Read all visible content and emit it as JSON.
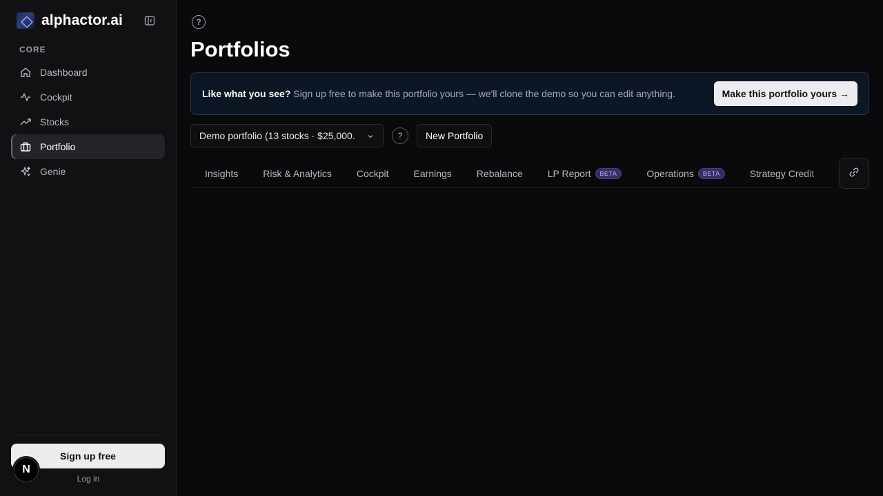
{
  "app": {
    "name": "alphactor.ai"
  },
  "sidebar": {
    "section_label": "CORE",
    "items": [
      {
        "label": "Dashboard",
        "icon": "home-icon",
        "active": false
      },
      {
        "label": "Cockpit",
        "icon": "activity-icon",
        "active": false
      },
      {
        "label": "Stocks",
        "icon": "trending-up-icon",
        "active": false
      },
      {
        "label": "Portfolio",
        "icon": "briefcase-icon",
        "active": true
      },
      {
        "label": "Genie",
        "icon": "sparkles-icon",
        "active": false
      }
    ],
    "signup_label": "Sign up free",
    "login_label": "Log in",
    "badge_letter": "N"
  },
  "header": {
    "help_glyph": "?",
    "title": "Portfolios"
  },
  "banner": {
    "bold": "Like what you see?",
    "text": " Sign up free to make this portfolio yours — we'll clone the demo so you can edit anything.",
    "button_label": "Make this portfolio yours →"
  },
  "portfolio_select": {
    "value": "Demo portfolio (13 stocks · $25,000.",
    "help_glyph": "?"
  },
  "new_portfolio_label": "New Portfolio",
  "tabs": [
    {
      "label": "Insights",
      "badge": ""
    },
    {
      "label": "Risk & Analytics",
      "badge": ""
    },
    {
      "label": "Cockpit",
      "badge": ""
    },
    {
      "label": "Earnings",
      "badge": ""
    },
    {
      "label": "Rebalance",
      "badge": ""
    },
    {
      "label": "LP Report",
      "badge": "BETA"
    },
    {
      "label": "Operations",
      "badge": "BETA"
    },
    {
      "label": "Strategy Credit",
      "badge": ""
    }
  ],
  "colors": {
    "background": "#0a0a0c",
    "sidebar": "#111114",
    "banner_bg": "#0d1624",
    "beta_badge": "#3a2d63"
  }
}
